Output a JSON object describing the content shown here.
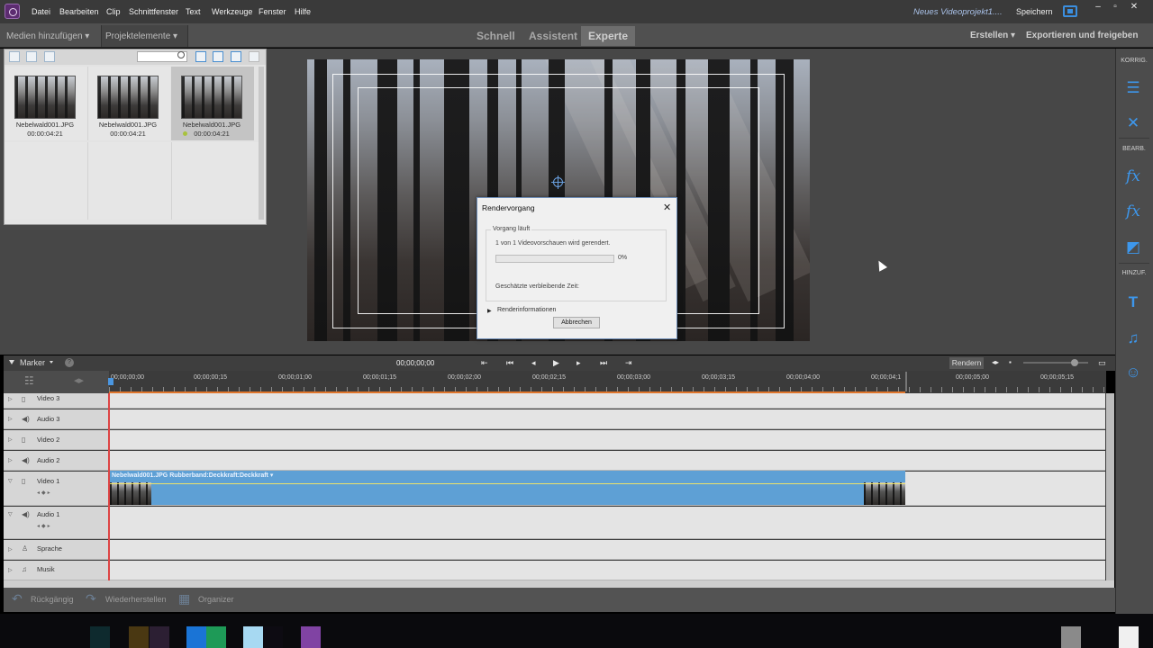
{
  "menubar": {
    "items": [
      "Datei",
      "Bearbeiten",
      "Clip",
      "Schnittfenster",
      "Text",
      "Werkzeuge",
      "Fenster",
      "Hilfe"
    ],
    "project_name": "Neues Videoprojekt1....",
    "save": "Speichern"
  },
  "toolbar": {
    "add_media": "Medien hinzufügen",
    "project_assets": "Projektelemente",
    "modes": [
      "Schnell",
      "Assistent",
      "Experte"
    ],
    "create": "Erstellen",
    "export": "Exportieren und freigeben"
  },
  "assets": [
    {
      "name": "Nebelwald001.JPG",
      "duration": "00:00:04:21"
    },
    {
      "name": "Nebelwald001.JPG",
      "duration": "00:00:04:21"
    },
    {
      "name": "Nebelwald001.JPG",
      "duration": "00:00:04:21"
    }
  ],
  "dialog": {
    "title": "Rendervorgang",
    "group": "Vorgang läuft",
    "status": "1 von 1 Videovorschauen wird gerendert.",
    "percent": "0%",
    "progress": 0,
    "remaining": "Geschätzte verbleibende Zeit:",
    "render_info": "Renderinformationen",
    "cancel": "Abbrechen"
  },
  "right_panel": {
    "label_correct": "KORRIG.",
    "label_edit": "BEARB.",
    "label_add": "HINZUF."
  },
  "timeline": {
    "marker": "Marker",
    "timecode": "00;00;00;00",
    "render": "Rendern",
    "ruler": [
      "00;00;00;00",
      "00;00;00;15",
      "00;00;01;00",
      "00;00;01;15",
      "00;00;02;00",
      "00;00;02;15",
      "00;00;03;00",
      "00;00;03;15",
      "00;00;04;00",
      "00;00;04;1",
      "00;00;05;00",
      "00;00;05;15"
    ],
    "tracks": [
      "Video 3",
      "Audio 3",
      "Video 2",
      "Audio 2",
      "Video 1",
      "Audio 1",
      "Sprache",
      "Musik"
    ],
    "clip_title": "Nebelwald001.JPG Rubberband:Deckkraft:Deckkraft ▾"
  },
  "bottom": {
    "undo": "Rückgängig",
    "redo": "Wiederherstellen",
    "organizer": "Organizer"
  },
  "colors": {
    "accent": "#3d97ec",
    "clip": "#5ea0d5",
    "render_bar": "#e0762c"
  }
}
